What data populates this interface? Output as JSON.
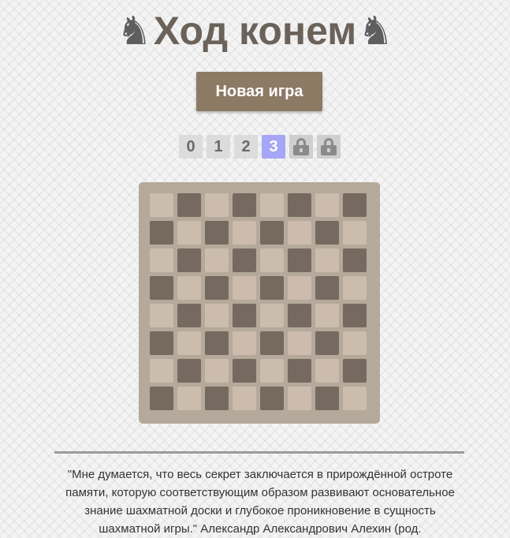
{
  "header": {
    "title": "Ход конем",
    "left_icon": "♞",
    "right_icon": "♞",
    "icon_names": [
      "chess-knight-icon",
      "chess-knight-icon"
    ]
  },
  "controls": {
    "new_game_label": "Новая игра"
  },
  "levels": {
    "items": [
      {
        "label": "0",
        "state": "unlocked"
      },
      {
        "label": "1",
        "state": "unlocked"
      },
      {
        "label": "2",
        "state": "unlocked"
      },
      {
        "label": "3",
        "state": "active"
      },
      {
        "label": "",
        "state": "locked",
        "icon": "lock-icon"
      },
      {
        "label": "",
        "state": "locked",
        "icon": "lock-icon"
      }
    ]
  },
  "board": {
    "size": 8,
    "colors": {
      "light": "#cbbcae",
      "dark": "#766a60",
      "frame": "#b5a99b"
    }
  },
  "quote": {
    "text": "\"Мне думается, что весь секрет заключается в прирождённой остроте памяти, которую соответствующим образом развивают основательное знание шахматной доски и глубокое проникновение в сущность шахматной игры.\" Александр Александрович Алехин (род."
  },
  "colors": {
    "accent": "#8d7a65",
    "active_level": "#a5a6f6",
    "title": "#6b625a"
  }
}
